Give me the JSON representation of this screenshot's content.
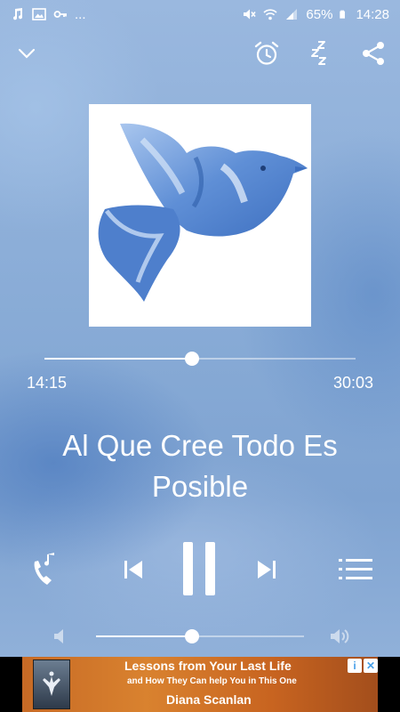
{
  "status_bar": {
    "battery_text": "65%",
    "clock": "14:28",
    "more": "..."
  },
  "player": {
    "elapsed": "14:15",
    "duration": "30:03",
    "progress_fraction": 0.474,
    "volume_fraction": 0.46,
    "song_title": "Al Que Cree Todo Es Posible"
  },
  "icons": {
    "collapse": "chevron-down-icon",
    "alarm": "alarm-clock-icon",
    "sleep": "sleep-timer-icon",
    "share": "share-icon",
    "ringtone": "ringtone-icon",
    "previous": "skip-previous-icon",
    "pause": "pause-icon",
    "next": "skip-next-icon",
    "queue": "queue-list-icon"
  },
  "ad": {
    "line1": "Lessons from Your Last Life",
    "line2": "and How They Can help You in This One",
    "line3": "Diana Scanlan"
  },
  "colors": {
    "background": "#8fb0d8",
    "ad_background": "#c76a25"
  }
}
